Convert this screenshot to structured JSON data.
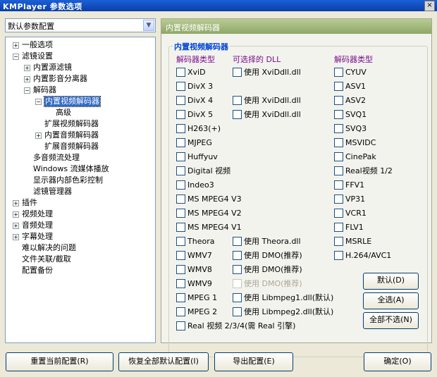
{
  "window": {
    "title": "KMPlayer 参数选项",
    "close_label": "×"
  },
  "profile": {
    "value": "默认参数配置"
  },
  "tree": [
    {
      "label": "一般选项",
      "expander": "+"
    },
    {
      "label": "滤镜设置",
      "expander": "−"
    },
    {
      "label": "内置源滤镜",
      "expander": "+"
    },
    {
      "label": "内置影音分离器",
      "expander": "+"
    },
    {
      "label": "解码器",
      "expander": "−"
    },
    {
      "label": "内置视频解码器",
      "expander": "−"
    },
    {
      "label": "高级",
      "expander": ""
    },
    {
      "label": "扩展视频解码器",
      "expander": ""
    },
    {
      "label": "内置音频解码器",
      "expander": "+"
    },
    {
      "label": "扩展音频解码器",
      "expander": ""
    },
    {
      "label": "多音频流处理",
      "expander": ""
    },
    {
      "label": "Windows 流媒体播放",
      "expander": ""
    },
    {
      "label": "显示器内部色彩控制",
      "expander": ""
    },
    {
      "label": "滤镜管理器",
      "expander": ""
    },
    {
      "label": "插件",
      "expander": "+"
    },
    {
      "label": "视频处理",
      "expander": "+"
    },
    {
      "label": "音频处理",
      "expander": "+"
    },
    {
      "label": "字幕处理",
      "expander": "+"
    },
    {
      "label": "难以解决的问题",
      "expander": ""
    },
    {
      "label": "文件关联/截取",
      "expander": ""
    },
    {
      "label": "配置备份",
      "expander": ""
    }
  ],
  "panel": {
    "header": "内置视频解码器",
    "group_title": "内置视频解码器",
    "col1_header": "解码器类型",
    "col2_header": "可选择的 DLL",
    "col3_header": "解码器类型",
    "col1": [
      "XviD",
      "DivX 3",
      "DivX 4",
      "DivX 5",
      "H263(+)",
      "MJPEG",
      "Huffyuv",
      "Digital 视频",
      "Indeo3",
      "MS MPEG4 V3",
      "MS MPEG4 V2",
      "MS MPEG4 V1",
      "Theora",
      "WMV7",
      "WMV8",
      "WMV9",
      "MPEG 1",
      "MPEG 2",
      "Real 视频 2/3/4(需 Real 引擎)"
    ],
    "col2": [
      "使用 XviDdll.dll",
      "使用 XviDdll.dll",
      "使用 XviDdll.dll",
      "使用 Theora.dll",
      "使用 DMO(推荐)",
      "使用 DMO(推荐)",
      "使用 DMO(推荐)",
      "使用 Libmpeg1.dll(默认)",
      "使用 Libmpeg2.dll(默认)"
    ],
    "col3": [
      "CYUV",
      "ASV1",
      "ASV2",
      "SVQ1",
      "SVQ3",
      "MSVIDC",
      "CinePak",
      "Real视频 1/2",
      "FFV1",
      "VP31",
      "VCR1",
      "FLV1",
      "MSRLE",
      "H.264/AVC1"
    ],
    "buttons": {
      "default": "默认(D)",
      "select_all": "全选(A)",
      "select_none": "全部不选(N)"
    }
  },
  "bottom_buttons": {
    "reset_current": "重置当前配置(R)",
    "restore_all": "恢复全部默认配置(I)",
    "export": "导出配置(E)",
    "ok": "确定(O)"
  }
}
